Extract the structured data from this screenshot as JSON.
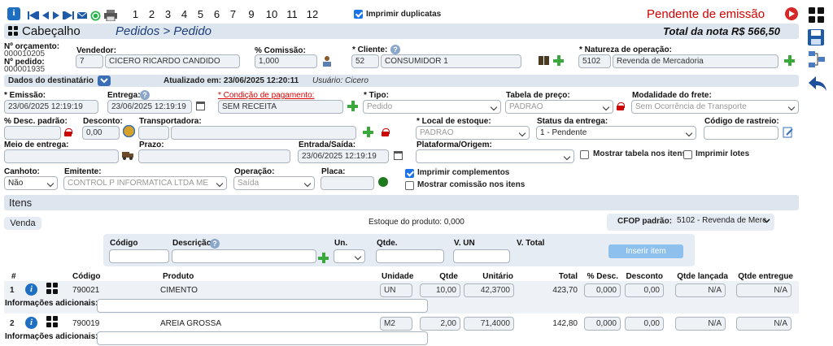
{
  "toolbar": {
    "numbers": [
      "1",
      "2",
      "3",
      "4",
      "5",
      "6",
      "7",
      "9",
      "10",
      "11",
      "12"
    ],
    "print_dup_label": "Imprimir duplicatas",
    "status": "Pendente de emissão"
  },
  "header": {
    "section": "Cabeçalho",
    "breadcrumb": "Pedidos > Pedido",
    "total": "Total da nota R$ 566,50"
  },
  "order": {
    "orc_label": "Nº orçamento:",
    "orc_value": "000010205",
    "ped_label": "Nº pedido:",
    "ped_value": "000001935",
    "vendedor_label": "Vendedor:",
    "vendedor_id": "7",
    "vendedor_name": "CICERO RICARDO CANDIDO",
    "comissao_label": "% Comissão:",
    "comissao_value": "1,000",
    "cliente_label": "* Cliente:",
    "cliente_id": "52",
    "cliente_name": "CONSUMIDOR 1",
    "natureza_label": "* Natureza de operação:",
    "natureza_id": "5102",
    "natureza_name": "Revenda de Mercadoria"
  },
  "dest": {
    "label": "Dados do destinatário",
    "updated": "Atualizado em: 23/06/2025 12:20:11",
    "user": "Usuário: Cicero"
  },
  "fields": {
    "emissao_label": "* Emissão:",
    "emissao_value": "23/06/2025 12:19:19",
    "entrega_label": "Entrega:",
    "entrega_value": "23/06/2025 12:19:19",
    "condicao_label": "* Condição de pagamento:",
    "condicao_value": "SEM RECEITA",
    "tipo_label": "* Tipo:",
    "tipo_value": "Pedido",
    "tabela_label": "Tabela de preço:",
    "tabela_value": "PADRAO",
    "frete_label": "Modalidade do frete:",
    "frete_value": "Sem Ocorrência de Transporte",
    "desc_padrao_label": "% Desc. padrão:",
    "desconto_label": "Desconto:",
    "desconto_value": "0,00",
    "transp_label": "Transportadora:",
    "local_label": "* Local de estoque:",
    "local_value": "PADRAO",
    "status_label": "Status da entrega:",
    "status_value": "1 - Pendente",
    "rastreio_label": "Código de rastreio:",
    "meio_label": "Meio de entrega:",
    "prazo_label": "Prazo:",
    "entrada_label": "Entrada/Saída:",
    "entrada_value": "23/06/2025 12:19:19",
    "plataforma_label": "Plataforma/Origem:",
    "mostrar_tabela": "Mostrar tabela nos itens",
    "imprimir_lotes": "Imprimir lotes",
    "canhoto_label": "Canhoto:",
    "canhoto_value": "Não",
    "emitente_label": "Emitente:",
    "emitente_value": "CONTROL P INFORMATICA LTDA ME",
    "operacao_label": "Operação:",
    "operacao_value": "Saída",
    "placa_label": "Placa:",
    "imprimir_comp": "Imprimir complementos",
    "mostrar_comissao": "Mostrar comissão nos itens"
  },
  "items": {
    "title": "Itens",
    "venda_btn": "Venda",
    "estoque": "Estoque do produto: 0,000",
    "cfop_label": "CFOP padrão:",
    "cfop_value": "5102 - Revenda de Merc",
    "add": {
      "codigo": "Código",
      "descricao": "Descrição",
      "un": "Un.",
      "qtde": "Qtde.",
      "vun": "V. UN",
      "vtotal": "V. Total",
      "button": "Inserir item"
    },
    "cols": [
      "#",
      "Código",
      "Produto",
      "Unidade",
      "Qtde",
      "Unitário",
      "Total",
      "% Desc.",
      "Desconto",
      "Qtde lançada",
      "Qtde entregue"
    ],
    "info_label": "Informações adicionais:",
    "rows": [
      {
        "n": "1",
        "codigo": "790021",
        "produto": "CIMENTO",
        "unidade": "UN",
        "qtde": "10,00",
        "unit": "42,3700",
        "total": "423,70",
        "pdesc": "0,000",
        "desc": "0,00",
        "lanc": "N/A",
        "entr": "N/A"
      },
      {
        "n": "2",
        "codigo": "790019",
        "produto": "AREIA GROSSA",
        "unidade": "M2",
        "qtde": "2,00",
        "unit": "71,4000",
        "total": "142,80",
        "pdesc": "0,000",
        "desc": "0,00",
        "lanc": "N/A",
        "entr": "N/A"
      }
    ]
  }
}
